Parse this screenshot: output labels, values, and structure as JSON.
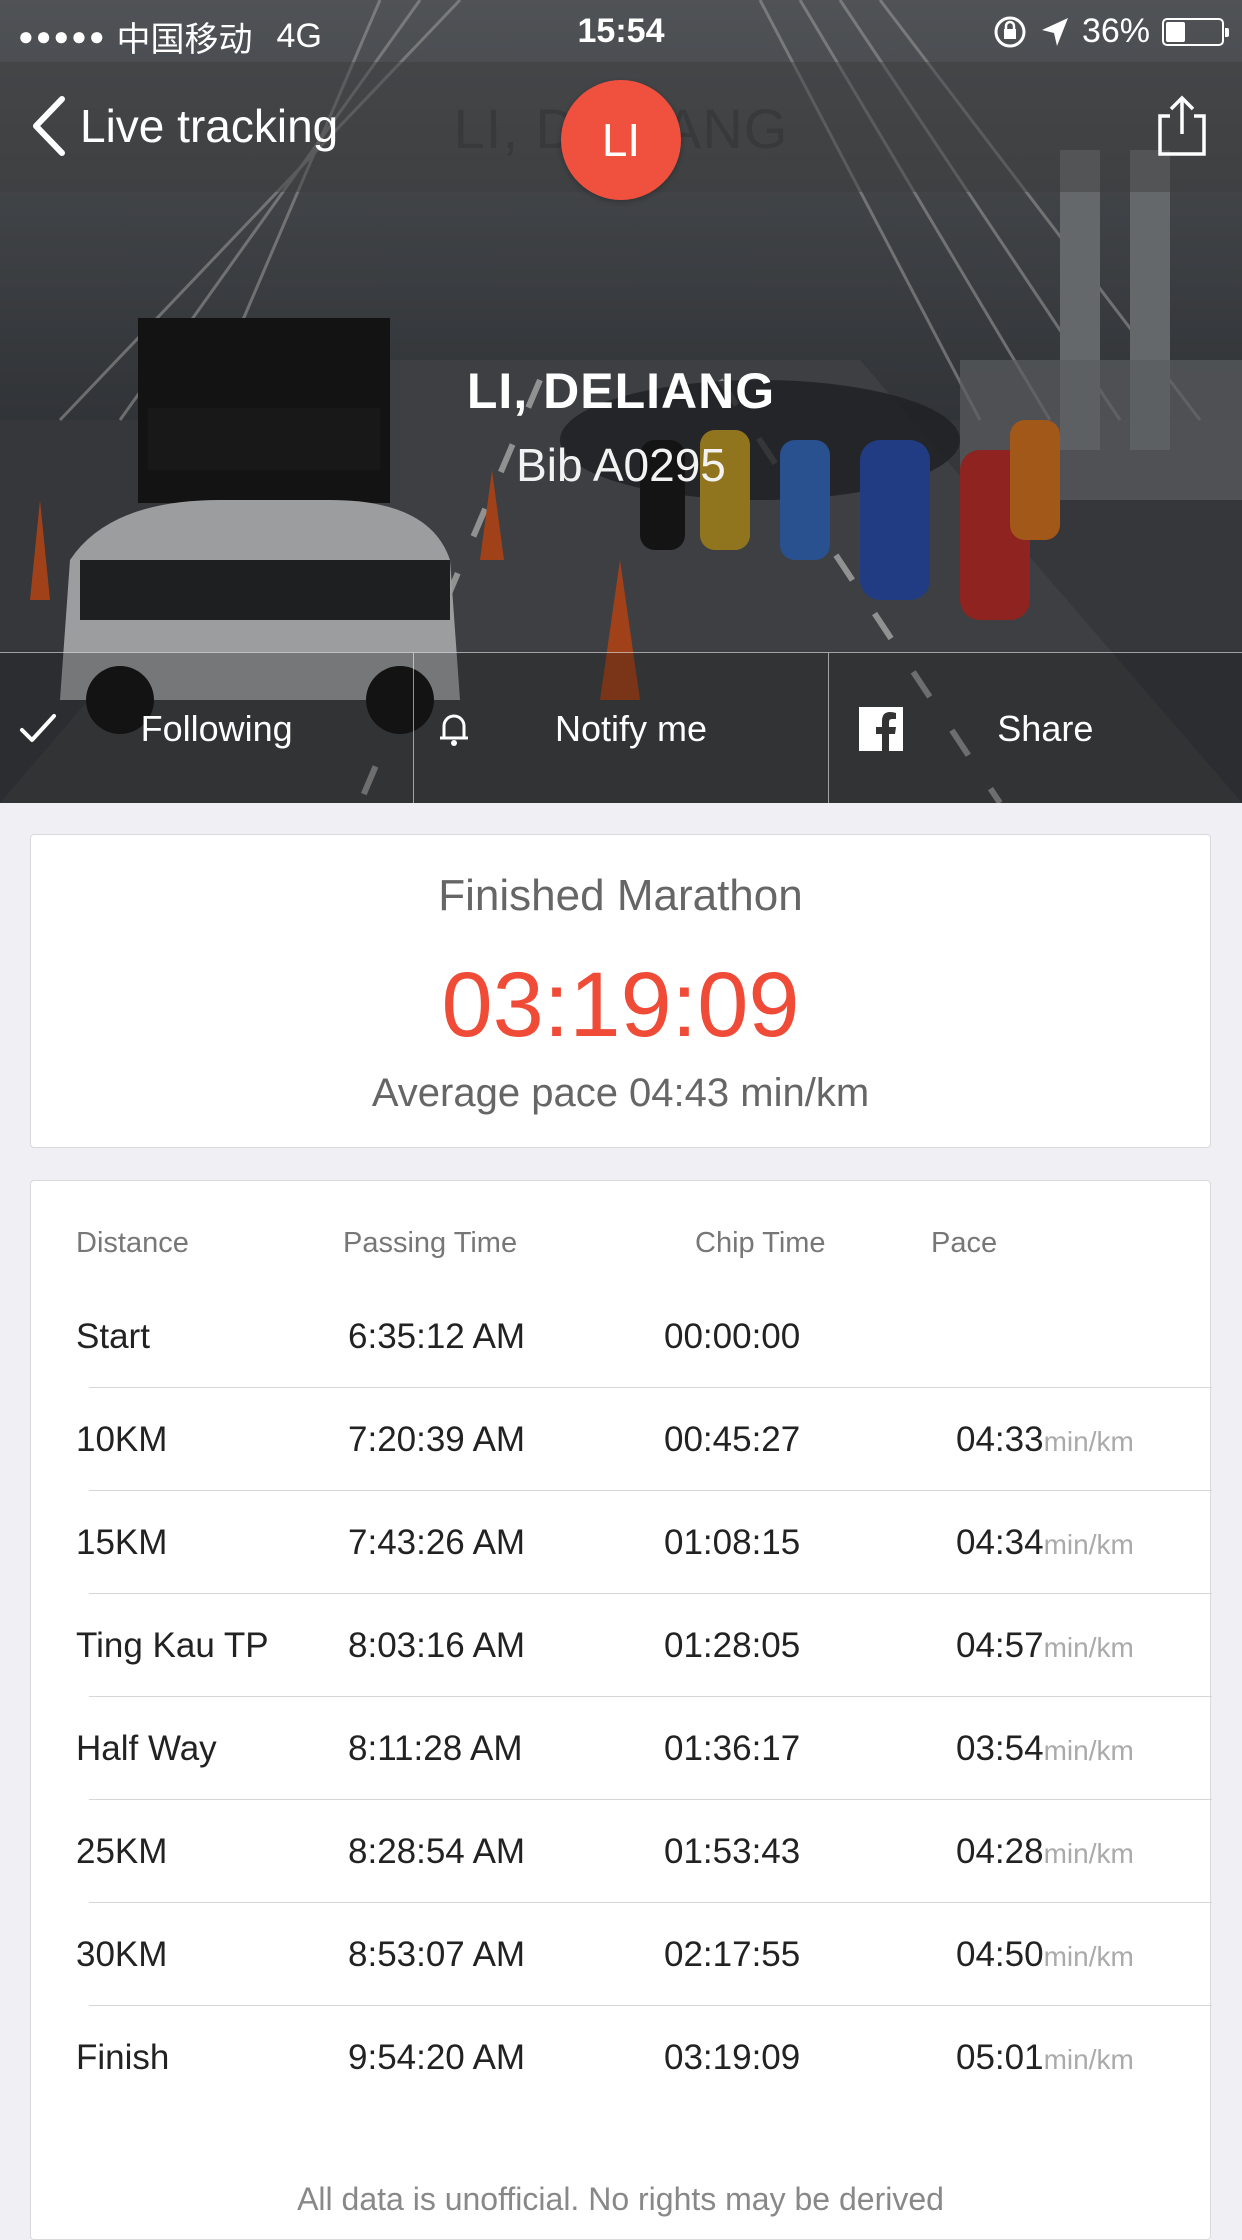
{
  "status_bar": {
    "carrier": "中国移动",
    "network": "4G",
    "time": "15:54",
    "battery": "36%",
    "battery_level": 0.36
  },
  "nav": {
    "back_label": "Live tracking",
    "ghost_title": "LI, DELIANG",
    "avatar_initials": "LI"
  },
  "runner": {
    "name": "LI, DELIANG",
    "bib": "Bib A0295"
  },
  "actions": {
    "following": "Following",
    "notify": "Notify me",
    "share": "Share"
  },
  "summary": {
    "title": "Finished Marathon",
    "time": "03:19:09",
    "average_pace": "Average pace 04:43 min/km"
  },
  "splits": {
    "headers": {
      "distance": "Distance",
      "passing_time": "Passing Time",
      "chip_time": "Chip Time",
      "pace": "Pace"
    },
    "pace_unit": "min/km",
    "rows": [
      {
        "distance": "Start",
        "passing_time": "6:35:12 AM",
        "chip_time": "00:00:00",
        "pace": ""
      },
      {
        "distance": "10KM",
        "passing_time": "7:20:39 AM",
        "chip_time": "00:45:27",
        "pace": "04:33"
      },
      {
        "distance": "15KM",
        "passing_time": "7:43:26 AM",
        "chip_time": "01:08:15",
        "pace": "04:34"
      },
      {
        "distance": "Ting Kau TP",
        "passing_time": "8:03:16 AM",
        "chip_time": "01:28:05",
        "pace": "04:57"
      },
      {
        "distance": "Half Way",
        "passing_time": "8:11:28 AM",
        "chip_time": "01:36:17",
        "pace": "03:54"
      },
      {
        "distance": "25KM",
        "passing_time": "8:28:54 AM",
        "chip_time": "01:53:43",
        "pace": "04:28"
      },
      {
        "distance": "30KM",
        "passing_time": "8:53:07 AM",
        "chip_time": "02:17:55",
        "pace": "04:50"
      },
      {
        "distance": "Finish",
        "passing_time": "9:54:20 AM",
        "chip_time": "03:19:09",
        "pace": "05:01"
      }
    ]
  },
  "disclaimer": "All data is unofficial. No rights may be derived",
  "colors": {
    "accent": "#ef4b37",
    "avatar": "#f0513f",
    "background": "#efeff4"
  }
}
